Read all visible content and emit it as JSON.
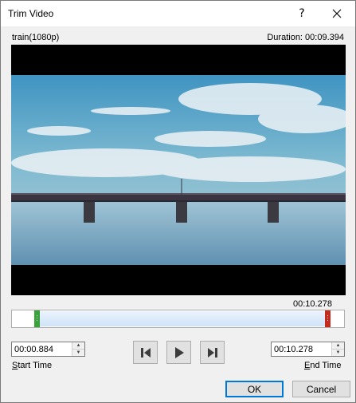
{
  "window": {
    "title": "Trim Video"
  },
  "titlebar": {
    "help": "?",
    "close": "✕"
  },
  "video": {
    "name": "train(1080p)",
    "duration": "Duration: 00:09.394"
  },
  "timeline": {
    "position": "00:10.278"
  },
  "start_time": {
    "value": "00:00.884",
    "label_first": "S",
    "label_rest": "tart Time"
  },
  "end_time": {
    "value": "00:10.278",
    "label_first": "E",
    "label_rest": "nd Time"
  },
  "buttons": {
    "ok": "OK",
    "cancel": "Cancel"
  },
  "icons": {
    "help": "help-icon",
    "close": "close-icon",
    "previous": "previous-frame-icon",
    "play": "play-icon",
    "next": "next-frame-icon"
  },
  "colors": {
    "start_handle": "#3aa23a",
    "end_handle": "#c42b1c",
    "accent": "#0078d7"
  }
}
